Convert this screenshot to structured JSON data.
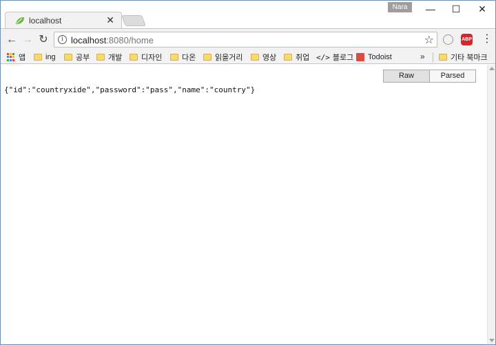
{
  "tab": {
    "title": "localhost",
    "close": "✕",
    "icon": "leaf-icon"
  },
  "profile": {
    "name": "Nara"
  },
  "window_controls": {
    "minimize": "—",
    "maximize": "☐",
    "close": "✕"
  },
  "toolbar": {
    "back": "←",
    "forward": "→",
    "reload": "↻",
    "url_host": "localhost",
    "url_path": ":8080/home",
    "info_glyph": "i",
    "star": "☆",
    "menu": "⋮",
    "abp": "ABP"
  },
  "bookmarks": {
    "items": [
      {
        "label": "앱",
        "type": "apps"
      },
      {
        "label": "ing",
        "type": "folder"
      },
      {
        "label": "공부",
        "type": "folder"
      },
      {
        "label": "개발",
        "type": "folder"
      },
      {
        "label": "디자인",
        "type": "folder"
      },
      {
        "label": "다온",
        "type": "folder"
      },
      {
        "label": "읽을거리",
        "type": "folder"
      },
      {
        "label": "영상",
        "type": "folder"
      },
      {
        "label": "취업",
        "type": "folder"
      },
      {
        "label": "블로그",
        "type": "code",
        "glyph": "</>"
      },
      {
        "label": "Todoist",
        "type": "todoist"
      }
    ],
    "overflow": "»",
    "other": "기타 북마크"
  },
  "viewer": {
    "raw": "Raw",
    "parsed": "Parsed"
  },
  "content": {
    "json_text": "{\"id\":\"countryxide\",\"password\":\"pass\",\"name\":\"country\"}"
  },
  "colors": {
    "abp": "#d9242b",
    "folder": "#f7d96f",
    "todoist": "#db4c3f",
    "frame": "#6f8fb2"
  }
}
